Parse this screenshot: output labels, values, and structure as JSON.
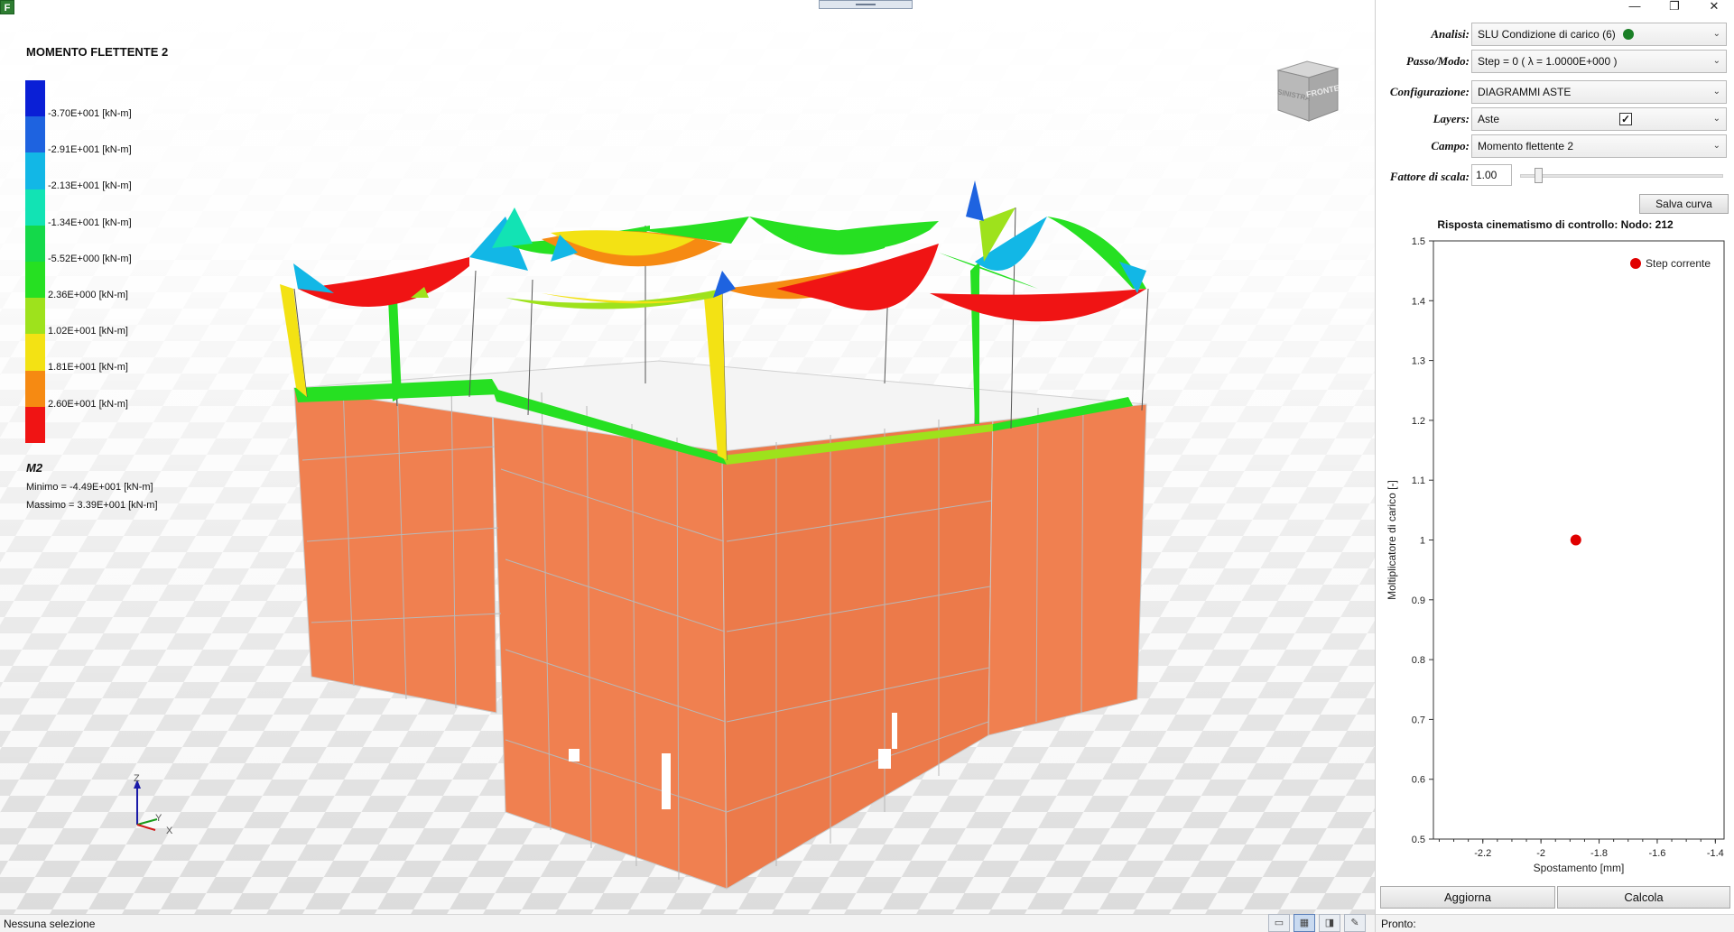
{
  "app": {
    "icon_letter": "F"
  },
  "legend": {
    "title": "MOMENTO FLETTENTE 2",
    "colors": [
      "#0a1fd6",
      "#1e63e0",
      "#12b7e6",
      "#12e3b4",
      "#14d94a",
      "#26e022",
      "#9ee21c",
      "#f3e214",
      "#f68a12",
      "#f01414"
    ],
    "labels": [
      "-3.70E+001 [kN-m]",
      "-2.91E+001 [kN-m]",
      "-2.13E+001 [kN-m]",
      "-1.34E+001 [kN-m]",
      "-5.52E+000 [kN-m]",
      "2.36E+000 [kN-m]",
      "1.02E+001 [kN-m]",
      "1.81E+001 [kN-m]",
      "2.60E+001 [kN-m]"
    ],
    "component": "M2",
    "min_text": "Minimo = -4.49E+001 [kN-m]",
    "max_text": "Massimo = 3.39E+001 [kN-m]"
  },
  "nav_cube": {
    "left_face": "SINISTRA",
    "front_face": "FRONTE"
  },
  "axes": {
    "z": "Z",
    "y": "Y",
    "x": "X"
  },
  "model": {
    "wall_color": "#f08050",
    "beam_colors": [
      "#f01414",
      "#f68a12",
      "#f3e214",
      "#9ee21c",
      "#26e022",
      "#12b7e6",
      "#1e63e0"
    ]
  },
  "status": {
    "left": "Nessuna selezione",
    "right": "Pronto:",
    "icons": [
      "frame-icon",
      "grid-icon",
      "shade-icon",
      "report-icon"
    ]
  },
  "window": {
    "minimize": "—",
    "restore": "❐",
    "close": "✕"
  },
  "panel": {
    "analisi_label": "Analisi:",
    "analisi_value": "SLU Condizione di carico (6)",
    "passo_label": "Passo/Modo:",
    "passo_value": "Step = 0 ( λ = 1.0000E+000 )",
    "config_label": "Configurazione:",
    "config_value": "DIAGRAMMI ASTE",
    "layers_label": "Layers:",
    "layers_value": "Aste",
    "layers_check": "✓",
    "campo_label": "Campo:",
    "campo_value": "Momento flettente 2",
    "scale_label": "Fattore di scala:",
    "scale_value": "1.00",
    "scale_slider_fraction": 0.09,
    "save_button": "Salva curva",
    "aggiorna_button": "Aggiorna",
    "calcola_button": "Calcola"
  },
  "chart_data": {
    "type": "scatter",
    "title": "Risposta cinematismo di controllo: Nodo: 212",
    "xlabel": "Spostamento [mm]",
    "ylabel": "Moltiplicatore di carico [-]",
    "xlim": [
      -2.37,
      -1.37
    ],
    "ylim": [
      0.5,
      1.5
    ],
    "x_ticks": [
      -2.2,
      -2,
      -1.8,
      -1.6,
      -1.4
    ],
    "x_tick_labels": [
      "-2.2",
      "-2",
      "-1.8",
      "-1.6",
      "-1.4"
    ],
    "y_ticks": [
      0.5,
      0.6,
      0.7,
      0.8,
      0.9,
      1,
      1.1,
      1.2,
      1.3,
      1.4,
      1.5
    ],
    "y_tick_labels": [
      "0.5",
      "0.6",
      "0.7",
      "0.8",
      "0.9",
      "1",
      "1.1",
      "1.2",
      "1.3",
      "1.4",
      "1.5"
    ],
    "series": [
      {
        "name": "Step corrente",
        "color": "#e00000",
        "x": [
          -1.88
        ],
        "y": [
          1.0
        ]
      }
    ],
    "legend_position": "top-right",
    "grid": false
  }
}
